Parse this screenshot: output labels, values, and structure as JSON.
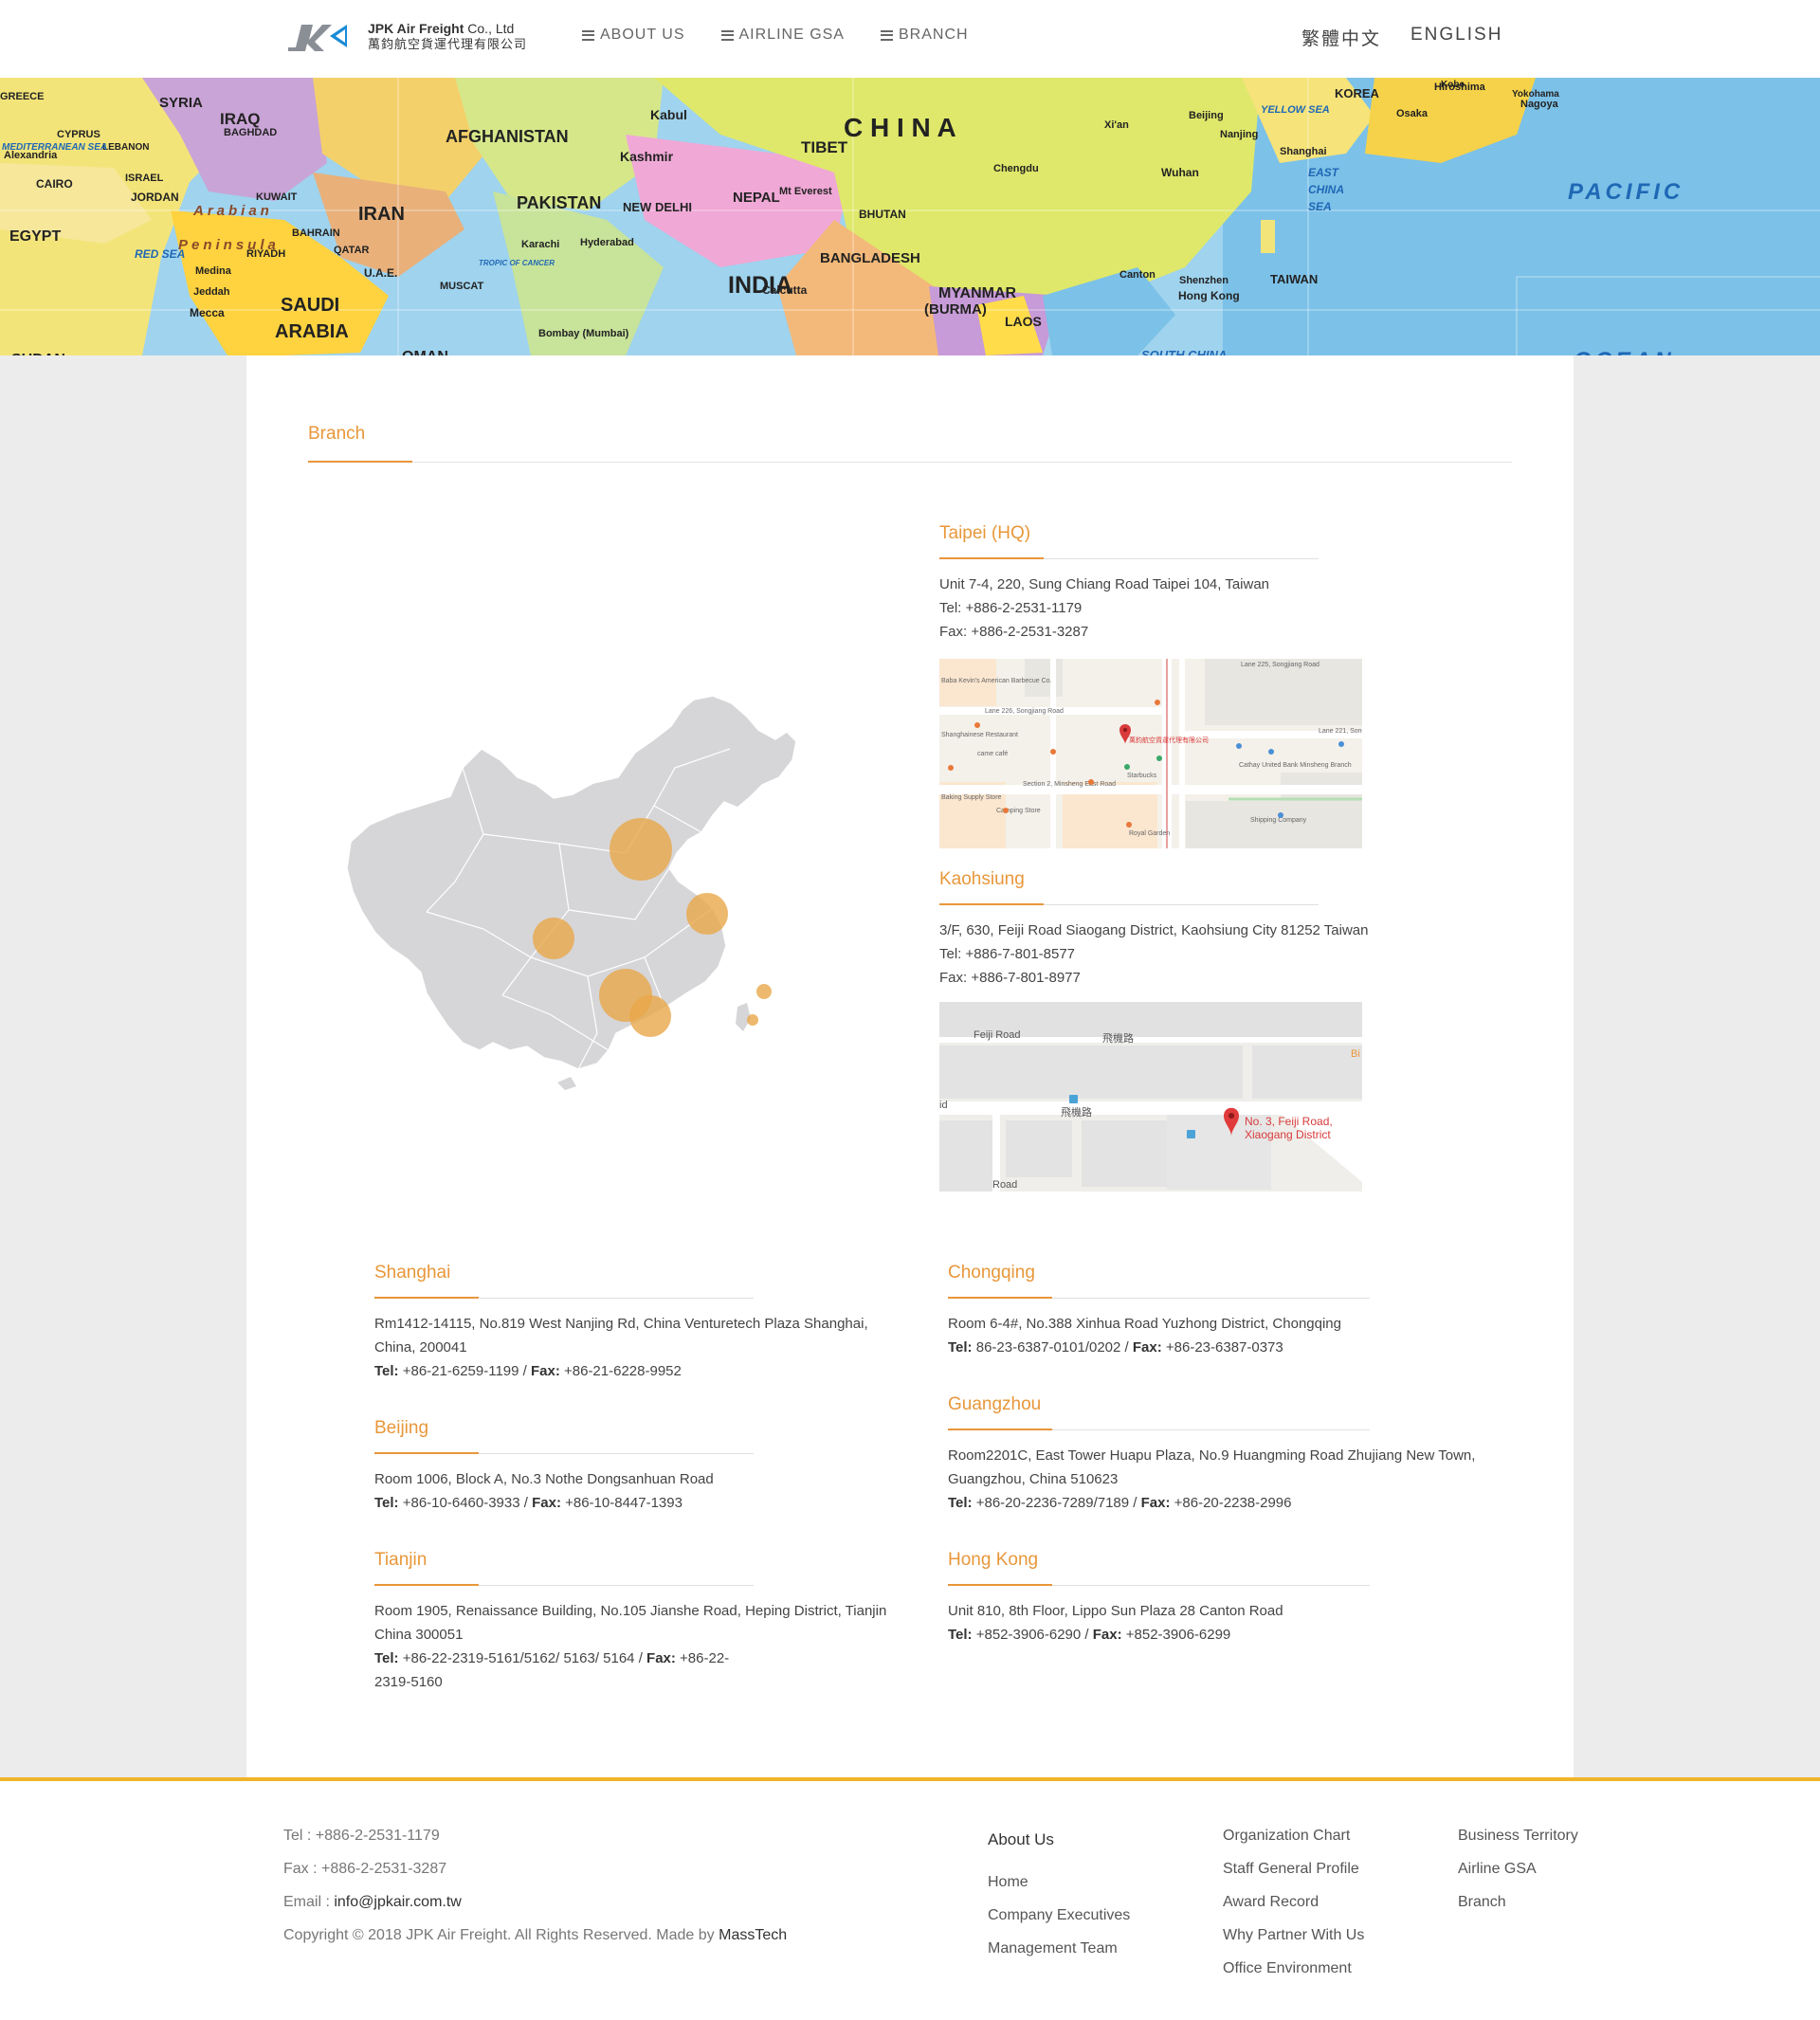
{
  "header": {
    "logo_en_bold": "JPK Air Freight",
    "logo_en_rest": " Co., Ltd",
    "logo_zh": "萬鈞航空貨運代理有限公司",
    "nav": [
      "ABOUT US",
      "AIRLINE GSA",
      "BRANCH"
    ],
    "lang_zh": "繁體中文",
    "lang_en": "ENGLISH"
  },
  "banner": {
    "labels": [
      "GREECE",
      "SYRIA",
      "IRAQ",
      "IRAN",
      "AFGHANISTAN",
      "PAKISTAN",
      "INDIA",
      "C H I N A",
      "TIBET",
      "NEPAL",
      "BHUTAN",
      "BANGLADESH",
      "MYANMAR",
      "(BURMA)",
      "LAOS",
      "SAUDI",
      "ARABIA",
      "EGYPT",
      "SUDAN",
      "OMAN",
      "KUWAIT",
      "QATAR",
      "U.A.E.",
      "BAHRAIN",
      "JORDAN",
      "ISRAEL",
      "LEBANON",
      "CYPRUS",
      "KOREA",
      "TAIWAN",
      "PACIFIC",
      "OCEAN",
      "SOUTH CHINA",
      "EAST",
      "CHINA",
      "SEA",
      "YELLOW SEA",
      "Arabian",
      "Peninsula",
      "MEDITERRANEAN SEA",
      "RED SEA",
      "Kabul",
      "Kashmir",
      "NEW DELHI",
      "Chengdu",
      "Wuhan",
      "Shanghai",
      "Nanjing",
      "Xi'an",
      "Beijing",
      "Hong Kong",
      "Shenzhen",
      "Canton",
      "Osaka",
      "Kobe",
      "Nagoya",
      "Yokohama",
      "Hiroshima",
      "Mt Everest",
      "Karachi",
      "Hyderabad",
      "Calcutta",
      "Bombay (Mumbai)",
      "Mecca",
      "Jeddah",
      "Medina",
      "RIYADH",
      "MUSCAT",
      "BAGHDAD",
      "CAIRO",
      "Alexandria",
      "TROPIC OF CANCER"
    ]
  },
  "branch_title": "Branch",
  "offices_main": [
    {
      "name": "Taipei (HQ)",
      "address": "Unit 7-4, 220, Sung Chiang Road Taipei 104, Taiwan",
      "tel": "Tel: +886-2-2531-1179",
      "fax": "Fax: +886-2-2531-3287"
    },
    {
      "name": "Kaohsiung",
      "address": "3/F, 630, Feiji Road Siaogang District, Kaohsiung City 81252 Taiwan",
      "tel": "Tel: +886-7-801-8577",
      "fax": "Fax: +886-7-801-8977"
    }
  ],
  "map_taipei": {
    "labels": [
      "Baba Kevin's American Barbecue Co.",
      "Lane 226, Songjiang Road",
      "Shanghainese Restaurant",
      "came café",
      "萬鈞航空貨運代理有限公司",
      "Starbucks",
      "Baking Supply Store",
      "Camping Store",
      "Section 2, Minsheng East Road",
      "Royal Garden",
      "Cathay United Bank Minsheng Branch",
      "Shipping Company",
      "Lane 221, Songjiang Road",
      "Lane 225, Songjiang Road"
    ]
  },
  "map_kaohsiung": {
    "labels": [
      "Feiji Road",
      "飛機路",
      "飛機路",
      "No. 3, Feiji Road,",
      "Xiaogang District",
      "Bi",
      "id",
      "Road"
    ]
  },
  "offices_grid": [
    {
      "name": "Shanghai",
      "address": "Rm1412-14115, No.819 West Nanjing Rd, China Venturetech Plaza Shanghai, China, 200041",
      "tel_label": "Tel:",
      "tel": " +86-21-6259-1199 / ",
      "fax_label": "Fax:",
      "fax": " +86-21-6228-9952"
    },
    {
      "name": "Chongqing",
      "address": "Room 6-4#, No.388 Xinhua Road Yuzhong District, Chongqing",
      "tel_label": "Tel:",
      "tel": " 86-23-6387-0101/0202 / ",
      "fax_label": "Fax:",
      "fax": " +86-23-6387-0373"
    },
    {
      "name": "Beijing",
      "address": "Room 1006, Block A, No.3 Nothe Dongsanhuan Road",
      "tel_label": "Tel:",
      "tel": " +86-10-6460-3933 / ",
      "fax_label": "Fax:",
      "fax": " +86-10-8447-1393"
    },
    {
      "name": "Guangzhou",
      "address": "Room2201C, East Tower Huapu Plaza, No.9 Huangming Road Zhujiang New Town, Guangzhou, China 510623",
      "tel_label": "Tel:",
      "tel": " +86-20-2236-7289/7189 / ",
      "fax_label": "Fax:",
      "fax": " +86-20-2238-2996"
    },
    {
      "name": "Tianjin",
      "address": "Room 1905, Renaissance Building, No.105 Jianshe Road, Heping District, Tianjin China 300051",
      "tel_label": "Tel:",
      "tel": " +86-22-2319-5161/5162/ 5163/ 5164 / ",
      "fax_label": "Fax:",
      "fax": " +86-22-2319-5160"
    },
    {
      "name": "Hong Kong",
      "address": "Unit 810, 8th Floor, Lippo Sun Plaza 28 Canton Road",
      "tel_label": "Tel:",
      "tel": " +852-3906-6290 / ",
      "fax_label": "Fax:",
      "fax": " +852-3906-6299"
    }
  ],
  "footer": {
    "tel": "Tel : +886-2-2531-1179",
    "fax": "Fax : +886-2-2531-3287",
    "email_label": "Email : ",
    "email": "info@jpkair.com.tw",
    "copyright": "Copyright © 2018 JPK Air Freight. All Rights Reserved. Made by ",
    "made_by": "MassTech",
    "col1_heading": "About Us",
    "col1": [
      "Home",
      "Company Executives",
      "Management Team"
    ],
    "col2": [
      "Organization Chart",
      "Staff General Profile",
      "Award Record",
      "Why Partner With Us",
      "Office Environment"
    ],
    "col3": [
      "Business Territory",
      "Airline GSA",
      "Branch"
    ]
  },
  "colors": {
    "accent": "#e8973a",
    "footer_border": "#f0b429",
    "map_bubble": "#e8a84a",
    "map_land": "#d6d6d8"
  }
}
